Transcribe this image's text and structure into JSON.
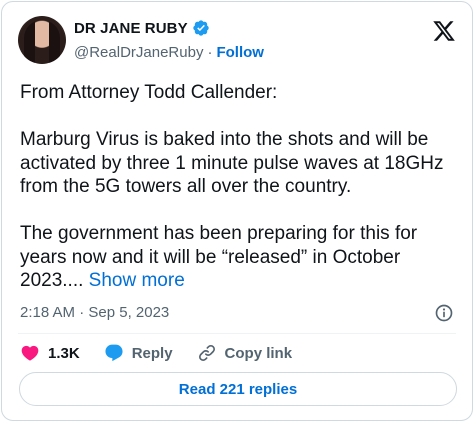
{
  "author": {
    "name": "DR JANE RUBY",
    "handle": "@RealDrJaneRuby",
    "separator": "·",
    "follow_label": "Follow"
  },
  "post": {
    "text": "From Attorney Todd Callender:\n\nMarburg Virus is baked into the shots and will be activated by three 1 minute pulse waves at 18GHz from the 5G towers all over the country.\n\nThe government has been preparing for this for years now and it will be “released” in October 2023....",
    "show_more_label": "Show more",
    "timestamp": "2:18 AM · Sep 5, 2023"
  },
  "actions": {
    "likes": "1.3K",
    "reply_label": "Reply",
    "copy_link_label": "Copy link"
  },
  "read_replies_label": "Read 221 replies",
  "icons": {
    "verified": "verified-badge-icon",
    "logo": "x-logo-icon",
    "info": "info-icon",
    "like": "heart-icon",
    "reply": "speech-bubble-icon",
    "copy": "link-icon"
  },
  "colors": {
    "accent": "#006fd6",
    "verified": "#1d9bf0",
    "like": "#f91880",
    "text": "#0f1419",
    "muted": "#536471"
  }
}
